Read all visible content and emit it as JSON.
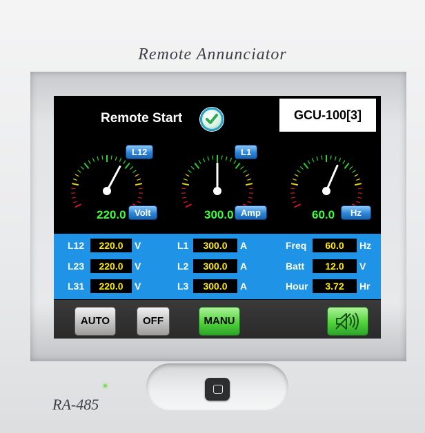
{
  "device": {
    "title": "Remote Annunciator",
    "model": "RA-485"
  },
  "header": {
    "remote_start_label": "Remote Start",
    "controller_id": "GCU-100[3]"
  },
  "gauges": [
    {
      "tag": "L12",
      "value": "220.0",
      "unit": "Volt",
      "needle_fraction": 0.62
    },
    {
      "tag": "L1",
      "value": "300.0",
      "unit": "Amp",
      "needle_fraction": 0.5
    },
    {
      "tag": "",
      "value": "60.0",
      "unit": "Hz",
      "needle_fraction": 0.6
    }
  ],
  "readings": {
    "voltage": [
      {
        "label": "L12",
        "value": "220.0",
        "unit": "V"
      },
      {
        "label": "L23",
        "value": "220.0",
        "unit": "V"
      },
      {
        "label": "L31",
        "value": "220.0",
        "unit": "V"
      }
    ],
    "current": [
      {
        "label": "L1",
        "value": "300.0",
        "unit": "A"
      },
      {
        "label": "L2",
        "value": "300.0",
        "unit": "A"
      },
      {
        "label": "L3",
        "value": "300.0",
        "unit": "A"
      }
    ],
    "misc": [
      {
        "label": "Freq",
        "value": "60.0",
        "unit": "Hz"
      },
      {
        "label": "Batt",
        "value": "12.0",
        "unit": "V"
      },
      {
        "label": "Hour",
        "value": "3.72",
        "unit": "Hr"
      }
    ]
  },
  "buttons": {
    "auto": "AUTO",
    "off": "OFF",
    "manu": "MANU",
    "mute_icon": "speaker-mute-icon"
  },
  "colors": {
    "screen_bg": "#000000",
    "panel_blue": "#1f94e6",
    "value_yellow": "#ffeb00",
    "gauge_green": "#3cff3c",
    "led_green": "#7ddc62"
  }
}
